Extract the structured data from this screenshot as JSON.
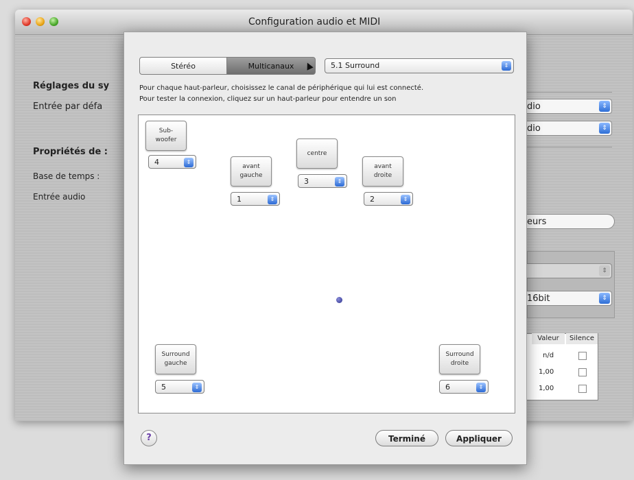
{
  "window": {
    "title": "Configuration audio et MIDI"
  },
  "background": {
    "section1_heading": "Réglages du sy",
    "default_input_label": "Entrée par défa",
    "section2_heading": "Propriétés de :",
    "timebase_label": "Base de temps :",
    "audio_input_label": "Entrée audio",
    "popup1_value": "dio",
    "popup2_value": "dio",
    "button_partial": "eurs",
    "format_value": "16bit",
    "table": {
      "headers": [
        "Valeur",
        "Silence"
      ],
      "rows": [
        {
          "value": "n/d"
        },
        {
          "value": "1,00"
        },
        {
          "value": "1,00"
        }
      ]
    }
  },
  "sheet": {
    "mode_tabs": [
      "Stéréo",
      "Multicanaux"
    ],
    "selected_tab": "Multicanaux",
    "config_select": "5.1 Surround",
    "instruction_line1": "Pour chaque haut-parleur, choisissez le canal de périphérique qui lui est connecté.",
    "instruction_line2": "Pour tester la connexion, cliquez sur un haut-parleur pour entendre un son",
    "speakers": {
      "subwoofer": {
        "label": "Sub-\nwoofer",
        "channel": "4"
      },
      "front_left": {
        "label": "avant\ngauche",
        "channel": "1"
      },
      "center": {
        "label": "centre",
        "channel": "3"
      },
      "front_right": {
        "label": "avant\ndroite",
        "channel": "2"
      },
      "surround_left": {
        "label": "Surround\ngauche",
        "channel": "5"
      },
      "surround_right": {
        "label": "Surround\ndroite",
        "channel": "6"
      }
    },
    "help_label": "?",
    "done_button": "Terminé",
    "apply_button": "Appliquer"
  },
  "colors": {
    "popup_arrow": "#2c6ad4",
    "selected_segment": "#7a7a7a"
  }
}
